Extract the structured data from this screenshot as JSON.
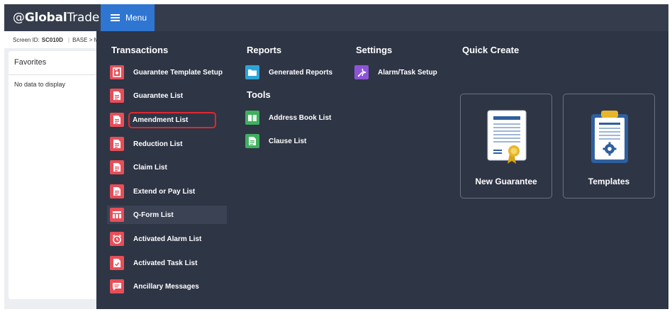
{
  "app": {
    "logo_prefix": "@",
    "logo_bold": "Global",
    "logo_light": "Trade"
  },
  "header": {
    "menu_label": "Menu"
  },
  "screen": {
    "id_label": "Screen ID:",
    "id_value": "SC010D",
    "breadcrumb": "BASE > M"
  },
  "favorites": {
    "title": "Favorites",
    "empty_text": "No data to display"
  },
  "menu": {
    "transactions": {
      "title": "Transactions",
      "items": [
        {
          "label": "Guarantee Template Setup",
          "icon": "template-icon"
        },
        {
          "label": "Guarantee List",
          "icon": "document-icon"
        },
        {
          "label": "Amendment List",
          "icon": "document-icon"
        },
        {
          "label": "Reduction List",
          "icon": "document-icon"
        },
        {
          "label": "Claim List",
          "icon": "document-icon"
        },
        {
          "label": "Extend or Pay List",
          "icon": "document-icon"
        },
        {
          "label": "Q-Form List",
          "icon": "table-icon"
        },
        {
          "label": "Activated Alarm List",
          "icon": "alarm-clock-icon"
        },
        {
          "label": "Activated Task List",
          "icon": "task-icon"
        },
        {
          "label": "Ancillary Messages",
          "icon": "message-icon"
        }
      ]
    },
    "reports": {
      "title": "Reports",
      "items": [
        {
          "label": "Generated Reports",
          "icon": "folder-icon"
        }
      ]
    },
    "tools": {
      "title": "Tools",
      "items": [
        {
          "label": "Address Book List",
          "icon": "book-icon"
        },
        {
          "label": "Clause List",
          "icon": "document-icon"
        }
      ]
    },
    "settings": {
      "title": "Settings",
      "items": [
        {
          "label": "Alarm/Task Setup",
          "icon": "alarm-setup-icon"
        }
      ]
    },
    "quick_create": {
      "title": "Quick Create",
      "cards": [
        {
          "label": "New Guarantee",
          "icon": "certificate-icon"
        },
        {
          "label": "Templates",
          "icon": "clipboard-gear-icon"
        }
      ]
    }
  },
  "colors": {
    "topbar": "#353d4d",
    "menu_button": "#2f76d2",
    "panel": "#2e3545",
    "red": "#e74e58",
    "blue": "#2ea4d6",
    "green": "#3fb05d",
    "purple": "#8c55d8",
    "highlight_outline": "#e2272e"
  }
}
